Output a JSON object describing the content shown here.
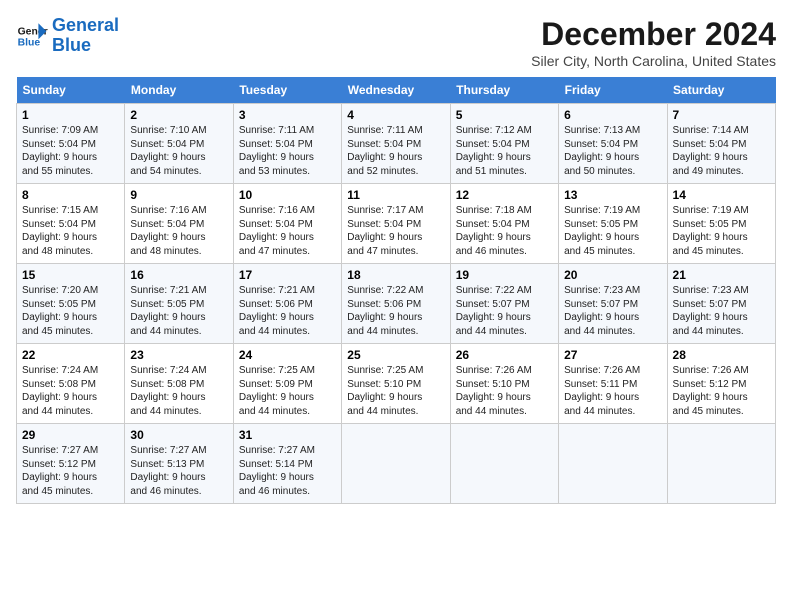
{
  "logo": {
    "line1": "General",
    "line2": "Blue"
  },
  "title": "December 2024",
  "location": "Siler City, North Carolina, United States",
  "days_of_week": [
    "Sunday",
    "Monday",
    "Tuesday",
    "Wednesday",
    "Thursday",
    "Friday",
    "Saturday"
  ],
  "weeks": [
    [
      {
        "day": "1",
        "content": "Sunrise: 7:09 AM\nSunset: 5:04 PM\nDaylight: 9 hours\nand 55 minutes."
      },
      {
        "day": "2",
        "content": "Sunrise: 7:10 AM\nSunset: 5:04 PM\nDaylight: 9 hours\nand 54 minutes."
      },
      {
        "day": "3",
        "content": "Sunrise: 7:11 AM\nSunset: 5:04 PM\nDaylight: 9 hours\nand 53 minutes."
      },
      {
        "day": "4",
        "content": "Sunrise: 7:11 AM\nSunset: 5:04 PM\nDaylight: 9 hours\nand 52 minutes."
      },
      {
        "day": "5",
        "content": "Sunrise: 7:12 AM\nSunset: 5:04 PM\nDaylight: 9 hours\nand 51 minutes."
      },
      {
        "day": "6",
        "content": "Sunrise: 7:13 AM\nSunset: 5:04 PM\nDaylight: 9 hours\nand 50 minutes."
      },
      {
        "day": "7",
        "content": "Sunrise: 7:14 AM\nSunset: 5:04 PM\nDaylight: 9 hours\nand 49 minutes."
      }
    ],
    [
      {
        "day": "8",
        "content": "Sunrise: 7:15 AM\nSunset: 5:04 PM\nDaylight: 9 hours\nand 48 minutes."
      },
      {
        "day": "9",
        "content": "Sunrise: 7:16 AM\nSunset: 5:04 PM\nDaylight: 9 hours\nand 48 minutes."
      },
      {
        "day": "10",
        "content": "Sunrise: 7:16 AM\nSunset: 5:04 PM\nDaylight: 9 hours\nand 47 minutes."
      },
      {
        "day": "11",
        "content": "Sunrise: 7:17 AM\nSunset: 5:04 PM\nDaylight: 9 hours\nand 47 minutes."
      },
      {
        "day": "12",
        "content": "Sunrise: 7:18 AM\nSunset: 5:04 PM\nDaylight: 9 hours\nand 46 minutes."
      },
      {
        "day": "13",
        "content": "Sunrise: 7:19 AM\nSunset: 5:05 PM\nDaylight: 9 hours\nand 45 minutes."
      },
      {
        "day": "14",
        "content": "Sunrise: 7:19 AM\nSunset: 5:05 PM\nDaylight: 9 hours\nand 45 minutes."
      }
    ],
    [
      {
        "day": "15",
        "content": "Sunrise: 7:20 AM\nSunset: 5:05 PM\nDaylight: 9 hours\nand 45 minutes."
      },
      {
        "day": "16",
        "content": "Sunrise: 7:21 AM\nSunset: 5:05 PM\nDaylight: 9 hours\nand 44 minutes."
      },
      {
        "day": "17",
        "content": "Sunrise: 7:21 AM\nSunset: 5:06 PM\nDaylight: 9 hours\nand 44 minutes."
      },
      {
        "day": "18",
        "content": "Sunrise: 7:22 AM\nSunset: 5:06 PM\nDaylight: 9 hours\nand 44 minutes."
      },
      {
        "day": "19",
        "content": "Sunrise: 7:22 AM\nSunset: 5:07 PM\nDaylight: 9 hours\nand 44 minutes."
      },
      {
        "day": "20",
        "content": "Sunrise: 7:23 AM\nSunset: 5:07 PM\nDaylight: 9 hours\nand 44 minutes."
      },
      {
        "day": "21",
        "content": "Sunrise: 7:23 AM\nSunset: 5:07 PM\nDaylight: 9 hours\nand 44 minutes."
      }
    ],
    [
      {
        "day": "22",
        "content": "Sunrise: 7:24 AM\nSunset: 5:08 PM\nDaylight: 9 hours\nand 44 minutes."
      },
      {
        "day": "23",
        "content": "Sunrise: 7:24 AM\nSunset: 5:08 PM\nDaylight: 9 hours\nand 44 minutes."
      },
      {
        "day": "24",
        "content": "Sunrise: 7:25 AM\nSunset: 5:09 PM\nDaylight: 9 hours\nand 44 minutes."
      },
      {
        "day": "25",
        "content": "Sunrise: 7:25 AM\nSunset: 5:10 PM\nDaylight: 9 hours\nand 44 minutes."
      },
      {
        "day": "26",
        "content": "Sunrise: 7:26 AM\nSunset: 5:10 PM\nDaylight: 9 hours\nand 44 minutes."
      },
      {
        "day": "27",
        "content": "Sunrise: 7:26 AM\nSunset: 5:11 PM\nDaylight: 9 hours\nand 44 minutes."
      },
      {
        "day": "28",
        "content": "Sunrise: 7:26 AM\nSunset: 5:12 PM\nDaylight: 9 hours\nand 45 minutes."
      }
    ],
    [
      {
        "day": "29",
        "content": "Sunrise: 7:27 AM\nSunset: 5:12 PM\nDaylight: 9 hours\nand 45 minutes."
      },
      {
        "day": "30",
        "content": "Sunrise: 7:27 AM\nSunset: 5:13 PM\nDaylight: 9 hours\nand 46 minutes."
      },
      {
        "day": "31",
        "content": "Sunrise: 7:27 AM\nSunset: 5:14 PM\nDaylight: 9 hours\nand 46 minutes."
      },
      {
        "day": "",
        "content": ""
      },
      {
        "day": "",
        "content": ""
      },
      {
        "day": "",
        "content": ""
      },
      {
        "day": "",
        "content": ""
      }
    ]
  ]
}
